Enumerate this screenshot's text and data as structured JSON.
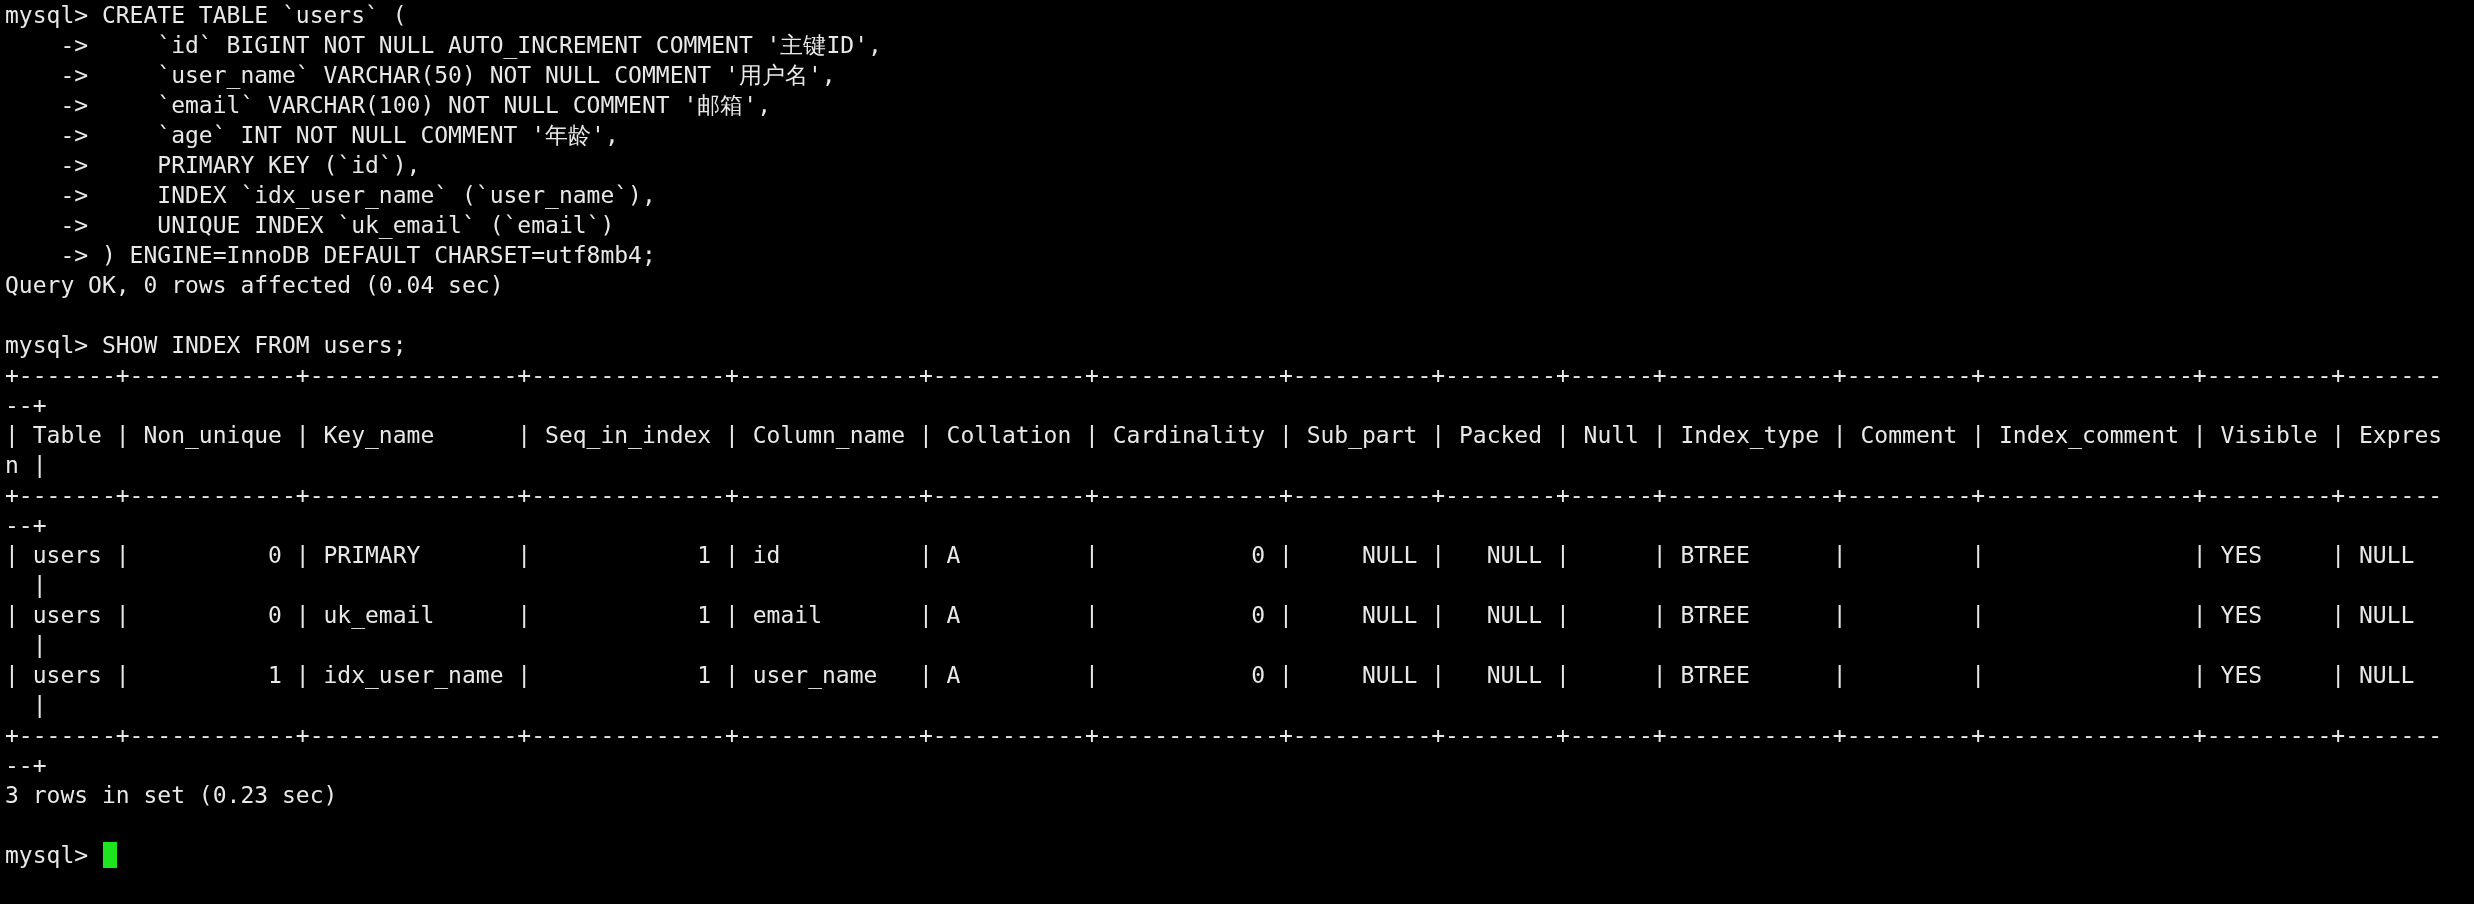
{
  "terminal": {
    "blocks": [
      [
        "mysql> CREATE TABLE `users` (",
        "    ->     `id` BIGINT NOT NULL AUTO_INCREMENT COMMENT '主键ID',",
        "    ->     `user_name` VARCHAR(50) NOT NULL COMMENT '用户名',",
        "    ->     `email` VARCHAR(100) NOT NULL COMMENT '邮箱',",
        "    ->     `age` INT NOT NULL COMMENT '年龄',",
        "    ->     PRIMARY KEY (`id`),",
        "    ->     INDEX `idx_user_name` (`user_name`),",
        "    ->     UNIQUE INDEX `uk_email` (`email`)",
        "    -> ) ENGINE=InnoDB DEFAULT CHARSET=utf8mb4;",
        "Query OK, 0 rows affected (0.04 sec)"
      ],
      [
        "mysql> SHOW INDEX FROM users;",
        "+-------+------------+---------------+--------------+-------------+-----------+-------------+----------+--------+------+------------+---------+---------------+---------+-------",
        "--+",
        "| Table | Non_unique | Key_name      | Seq_in_index | Column_name | Collation | Cardinality | Sub_part | Packed | Null | Index_type | Comment | Index_comment | Visible | Expres",
        "n |",
        "+-------+------------+---------------+--------------+-------------+-----------+-------------+----------+--------+------+------------+---------+---------------+---------+-------",
        "--+",
        "| users |          0 | PRIMARY       |            1 | id          | A         |           0 |     NULL |   NULL |      | BTREE      |         |               | YES     | NULL",
        "  |",
        "| users |          0 | uk_email      |            1 | email       | A         |           0 |     NULL |   NULL |      | BTREE      |         |               | YES     | NULL",
        "  |",
        "| users |          1 | idx_user_name |            1 | user_name   | A         |           0 |     NULL |   NULL |      | BTREE      |         |               | YES     | NULL",
        "  |",
        "+-------+------------+---------------+--------------+-------------+-----------+-------------+----------+--------+------+------------+---------+---------------+---------+-------",
        "--+",
        "3 rows in set (0.23 sec)"
      ]
    ],
    "prompt": {
      "text": "mysql>",
      "cursor": true
    }
  }
}
